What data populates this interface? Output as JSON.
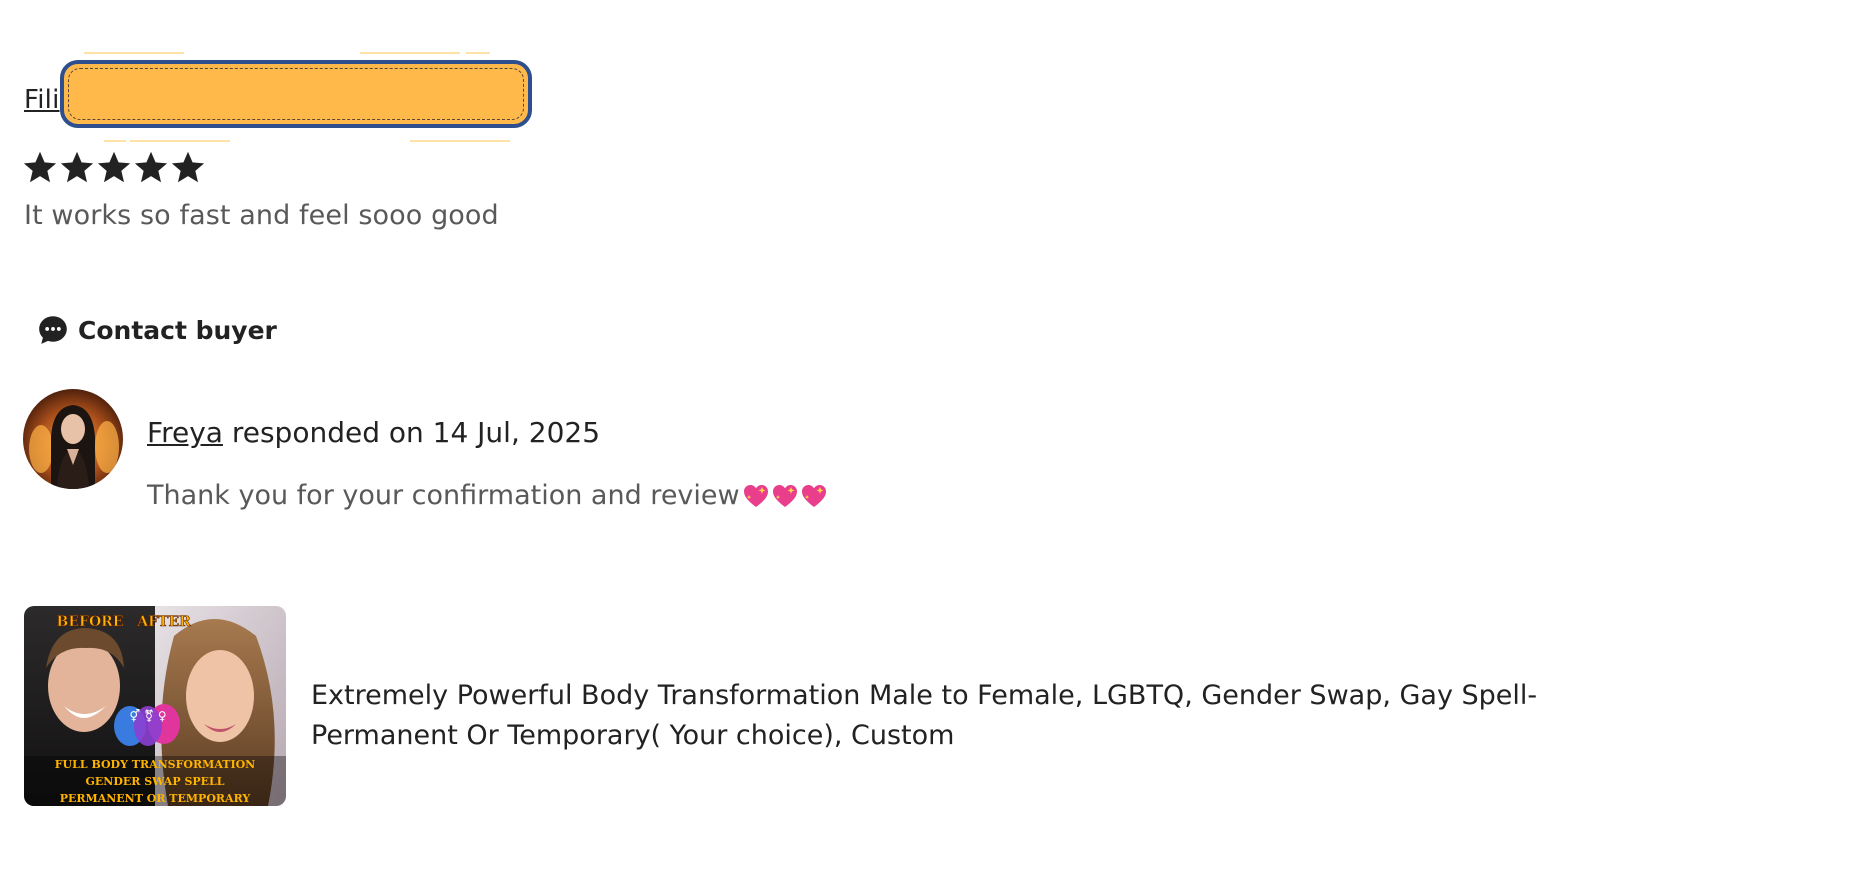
{
  "review": {
    "reviewer_name_visible": "Fili",
    "rating": 5,
    "rating_max": 5,
    "text": "It works so fast and feel sooo good"
  },
  "contact": {
    "label": "Contact buyer",
    "icon": "chat-bubble-icon"
  },
  "response": {
    "responder": "Freya",
    "responded_text": "responded on 14 Jul, 2025",
    "message": "Thank you for your confirmation and review",
    "emoji_icons": [
      "sparkling-heart-icon",
      "sparkling-heart-icon",
      "sparkling-heart-icon"
    ]
  },
  "listing": {
    "title": "Extremely Powerful Body Transformation Male to Female, LGBTQ, Gender Swap, Gay Spell-Permanent Or Temporary( Your choice), Custom",
    "thumbnail": {
      "top_left_text": "BEFORE",
      "top_right_text": "AFTER",
      "line1": "FULL BODY TRANSFORMATION",
      "line2": "GENDER SWAP SPELL",
      "line3": "PERMANENT OR TEMPORARY"
    }
  },
  "colors": {
    "redaction_fill": "#ffb84a",
    "redaction_border": "#2d4f8e",
    "text_primary": "#222222",
    "text_secondary": "#595959",
    "heart": "#e83e8c"
  }
}
